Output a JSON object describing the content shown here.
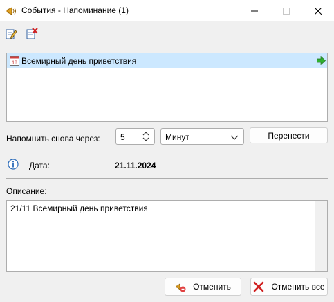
{
  "window": {
    "title": "События - Напоминание (1)"
  },
  "toolbar": {
    "edit_icon": "edit-event-icon",
    "delete_icon": "delete-event-icon"
  },
  "events": [
    {
      "title": "Всемирный день приветствия",
      "icon": "calendar-icon",
      "action_icon": "green-arrow-icon"
    }
  ],
  "snooze": {
    "label": "Напомнить снова через:",
    "value": "5",
    "unit": "Минут",
    "postpone_label": "Перенести"
  },
  "details": {
    "date_label": "Дата:",
    "date_value": "21.11.2024"
  },
  "description": {
    "label": "Описание:",
    "text": "21/11 Всемирный день приветствия"
  },
  "actions": {
    "cancel_label": "Отменить",
    "cancel_all_label": "Отменить все"
  },
  "colors": {
    "selection": "#cce8ff",
    "border": "#adadad",
    "window_bg": "#f0f0f0"
  }
}
